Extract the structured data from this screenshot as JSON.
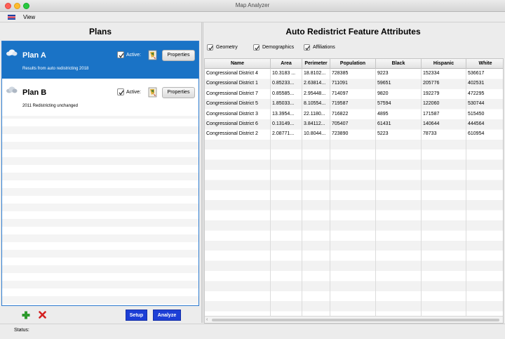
{
  "window": {
    "title": "Map Analyzer"
  },
  "menu": {
    "view": "View"
  },
  "plans": {
    "title": "Plans",
    "items": [
      {
        "name": "Plan A",
        "description": "Results from auto redistricting 2018",
        "active_label": "Active:",
        "properties_label": "Properties",
        "selected": true
      },
      {
        "name": "Plan B",
        "description": "2011 Redistricting unchanged",
        "active_label": "Active:",
        "properties_label": "Properties",
        "selected": false
      }
    ],
    "setup_label": "Setup",
    "analyze_label": "Analyze"
  },
  "attributes": {
    "title": "Auto Redistrict Feature Attributes",
    "filters": [
      {
        "label": "Geometry",
        "checked": true
      },
      {
        "label": "Demographics",
        "checked": true
      },
      {
        "label": "Affiliations",
        "checked": true
      }
    ],
    "columns": [
      "Name",
      "Area",
      "Perimeter",
      "Population",
      "Black",
      "Hispanic",
      "White"
    ],
    "rows": [
      [
        "Congressional District 4",
        "10.3183 ...",
        "18.8102...",
        "728385",
        "9223",
        "152334",
        "536617"
      ],
      [
        "Congressional District 1",
        "0.85233...",
        "2.63814...",
        "711091",
        "59651",
        "205776",
        "402531"
      ],
      [
        "Congressional District 7",
        "0.85585...",
        "2.95448...",
        "714097",
        "9820",
        "192279",
        "472295"
      ],
      [
        "Congressional District 5",
        "1.85033...",
        "8.10554...",
        "719587",
        "57594",
        "122060",
        "530744"
      ],
      [
        "Congressional District 3",
        "13.3954...",
        "22.1180...",
        "716822",
        "4895",
        "171587",
        "515450"
      ],
      [
        "Congressional District 6",
        "0.13149...",
        "3.84112...",
        "705407",
        "61431",
        "140644",
        "444564"
      ],
      [
        "Congressional District 2",
        "2.08771...",
        "10.8044...",
        "723890",
        "5223",
        "78733",
        "610954"
      ]
    ]
  },
  "status": {
    "label": "Status:"
  },
  "colors": {
    "selection": "#1a73c6",
    "button": "#1d3fd6"
  }
}
